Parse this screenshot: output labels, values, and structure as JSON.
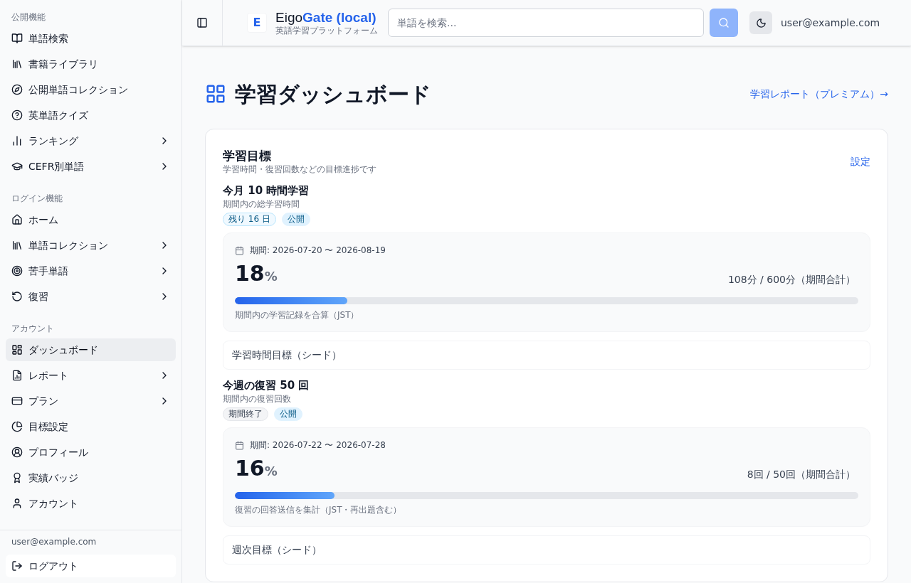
{
  "sidebar": {
    "sections": [
      {
        "heading": "公開機能",
        "items": [
          {
            "label": "単語検索",
            "has_submenu": false,
            "selected": false
          },
          {
            "label": "書籍ライブラリ",
            "has_submenu": false,
            "selected": false
          },
          {
            "label": "公開単語コレクション",
            "has_submenu": false,
            "selected": false
          },
          {
            "label": "英単語クイズ",
            "has_submenu": false,
            "selected": false
          },
          {
            "label": "ランキング",
            "has_submenu": true,
            "selected": false
          },
          {
            "label": "CEFR別単語",
            "has_submenu": true,
            "selected": false
          }
        ]
      },
      {
        "heading": "ログイン機能",
        "items": [
          {
            "label": "ホーム",
            "has_submenu": false,
            "selected": false
          },
          {
            "label": "単語コレクション",
            "has_submenu": true,
            "selected": false
          },
          {
            "label": "苦手単語",
            "has_submenu": true,
            "selected": false
          },
          {
            "label": "復習",
            "has_submenu": true,
            "selected": false
          }
        ]
      },
      {
        "heading": "アカウント",
        "items": [
          {
            "label": "ダッシュボード",
            "has_submenu": false,
            "selected": true
          },
          {
            "label": "レポート",
            "has_submenu": true,
            "selected": false
          },
          {
            "label": "プラン",
            "has_submenu": true,
            "selected": false
          },
          {
            "label": "目標設定",
            "has_submenu": false,
            "selected": false
          },
          {
            "label": "プロフィール",
            "has_submenu": false,
            "selected": false
          },
          {
            "label": "実績バッジ",
            "has_submenu": false,
            "selected": false
          },
          {
            "label": "アカウント",
            "has_submenu": false,
            "selected": false
          }
        ]
      }
    ],
    "user_email": "user@example.com",
    "logout": "ログアウト"
  },
  "header": {
    "logo_letter": "E",
    "brand_plain": "Eigo",
    "brand_accent": "Gate (local)",
    "tagline": "英語学習プラットフォーム",
    "search": {
      "placeholder": "単語を検索..."
    },
    "user_email": "user@example.com"
  },
  "page": {
    "title": "学習ダッシュボード",
    "report_link": "学習レポート（プレミアム）→"
  },
  "goals_card": {
    "title": "学習目標",
    "subtitle": "学習時間・復習回数などの目標進捗です",
    "settings_link": "設定",
    "goals": [
      {
        "title": "今月 10 時間学習",
        "description": "期間内の総学習時間",
        "badges": [
          {
            "kind": "remaining",
            "label": "残り 16 日"
          },
          {
            "kind": "public",
            "label": "公開"
          }
        ],
        "period": "期間: 2026-07-20 〜 2026-08-19",
        "percent": "18",
        "percent_sign": "%",
        "amount": "108分 / 600分（期間合計）",
        "level": 0.18,
        "note": "期間内の学習記録を合算（JST）",
        "source": "学習時間目標（シード）"
      },
      {
        "title": "今週の復習 50 回",
        "description": "期間内の復習回数",
        "badges": [
          {
            "kind": "ended",
            "label": "期間終了"
          },
          {
            "kind": "public",
            "label": "公開"
          }
        ],
        "period": "期間: 2026-07-22 〜 2026-07-28",
        "percent": "16",
        "percent_sign": "%",
        "amount": "8回 / 50回（期間合計）",
        "level": 0.16,
        "note": "復習の回答送信を集計（JST・再出題含む）",
        "source": "週次目標（シード）"
      }
    ]
  }
}
